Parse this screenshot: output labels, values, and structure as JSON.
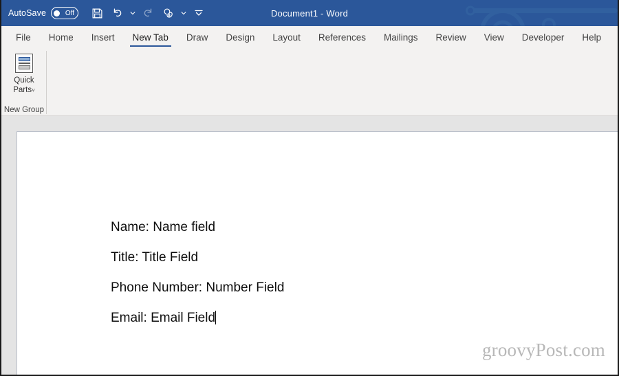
{
  "titlebar": {
    "autosave_label": "AutoSave",
    "autosave_state": "Off",
    "document_title": "Document1  -  Word",
    "quick_access": [
      {
        "name": "save-icon",
        "label": "Save"
      },
      {
        "name": "undo-icon",
        "label": "Undo"
      },
      {
        "name": "undo-dropdown-caret",
        "label": "˅"
      },
      {
        "name": "redo-icon",
        "label": "Redo"
      },
      {
        "name": "touch-mode-icon",
        "label": "Touch/Mouse Mode"
      },
      {
        "name": "touch-mode-caret",
        "label": "˅"
      },
      {
        "name": "customize-toolbar-icon",
        "label": "Customize Quick Access Toolbar"
      }
    ],
    "bg_color": "#2b579a"
  },
  "tabs": [
    {
      "label": "File",
      "active": false
    },
    {
      "label": "Home",
      "active": false
    },
    {
      "label": "Insert",
      "active": false
    },
    {
      "label": "New Tab",
      "active": true
    },
    {
      "label": "Draw",
      "active": false
    },
    {
      "label": "Design",
      "active": false
    },
    {
      "label": "Layout",
      "active": false
    },
    {
      "label": "References",
      "active": false
    },
    {
      "label": "Mailings",
      "active": false
    },
    {
      "label": "Review",
      "active": false
    },
    {
      "label": "View",
      "active": false
    },
    {
      "label": "Developer",
      "active": false
    },
    {
      "label": "Help",
      "active": false
    }
  ],
  "ribbon": {
    "group_title": "New Group",
    "quick_parts": {
      "label_line1": "Quick",
      "label_line2": "Parts",
      "caret": "˅",
      "icon": "quick-parts-icon"
    },
    "accent_color": "#2b579a",
    "bg_color": "#f3f2f1"
  },
  "document": {
    "lines": [
      "Name: Name field",
      "Title: Title Field",
      "Phone Number: Number Field",
      "Email: Email Field"
    ],
    "cursor_after_line_index": 3,
    "watermark": "groovyPost.com"
  }
}
